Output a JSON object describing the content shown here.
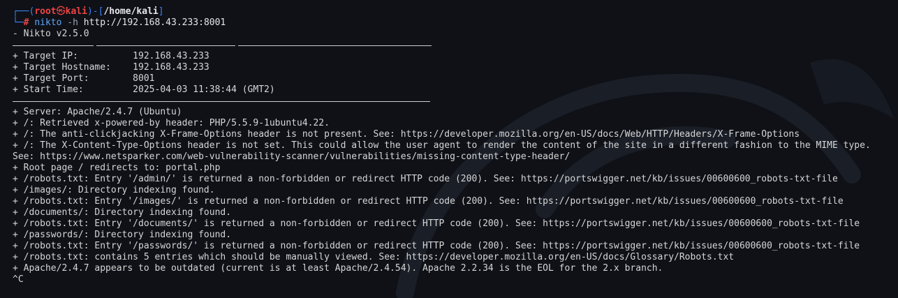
{
  "prompt": {
    "user": "root",
    "at_symbol": "㉿",
    "host": "kali",
    "cwd": "/home/kali",
    "hash": "#",
    "command": "nikto",
    "flag": "-h",
    "argument": "http://192.168.43.233:8001"
  },
  "output": {
    "banner": "- Nikto v2.5.0",
    "target_ip": "+ Target IP:          192.168.43.233",
    "target_hostname": "+ Target Hostname:    192.168.43.233",
    "target_port": "+ Target Port:        8001",
    "start_time": "+ Start Time:         2025-04-03 11:38:44 (GMT2)",
    "findings": [
      "+ Server: Apache/2.4.7 (Ubuntu)",
      "+ /: Retrieved x-powered-by header: PHP/5.5.9-1ubuntu4.22.",
      "+ /: The anti-clickjacking X-Frame-Options header is not present. See: https://developer.mozilla.org/en-US/docs/Web/HTTP/Headers/X-Frame-Options",
      "+ /: The X-Content-Type-Options header is not set. This could allow the user agent to render the content of the site in a different fashion to the MIME type.",
      "See: https://www.netsparker.com/web-vulnerability-scanner/vulnerabilities/missing-content-type-header/",
      "+ Root page / redirects to: portal.php",
      "+ /robots.txt: Entry '/admin/' is returned a non-forbidden or redirect HTTP code (200). See: https://portswigger.net/kb/issues/00600600_robots-txt-file",
      "+ /images/: Directory indexing found.",
      "+ /robots.txt: Entry '/images/' is returned a non-forbidden or redirect HTTP code (200). See: https://portswigger.net/kb/issues/00600600_robots-txt-file",
      "+ /documents/: Directory indexing found.",
      "+ /robots.txt: Entry '/documents/' is returned a non-forbidden or redirect HTTP code (200). See: https://portswigger.net/kb/issues/00600600_robots-txt-file",
      "+ /passwords/: Directory indexing found.",
      "+ /robots.txt: Entry '/passwords/' is returned a non-forbidden or redirect HTTP code (200). See: https://portswigger.net/kb/issues/00600600_robots-txt-file",
      "+ /robots.txt: contains 5 entries which should be manually viewed. See: https://developer.mozilla.org/en-US/docs/Glossary/Robots.txt",
      "+ Apache/2.4.7 appears to be outdated (current is at least Apache/2.4.54). Apache 2.2.34 is the EOL for the 2.x branch."
    ],
    "interrupt": "^C"
  },
  "colors": {
    "background": "#0f1117",
    "prompt_frame": "#3b82f6",
    "user_host": "#ef4444",
    "command": "#60a5fa",
    "text": "#d6d6d6"
  }
}
